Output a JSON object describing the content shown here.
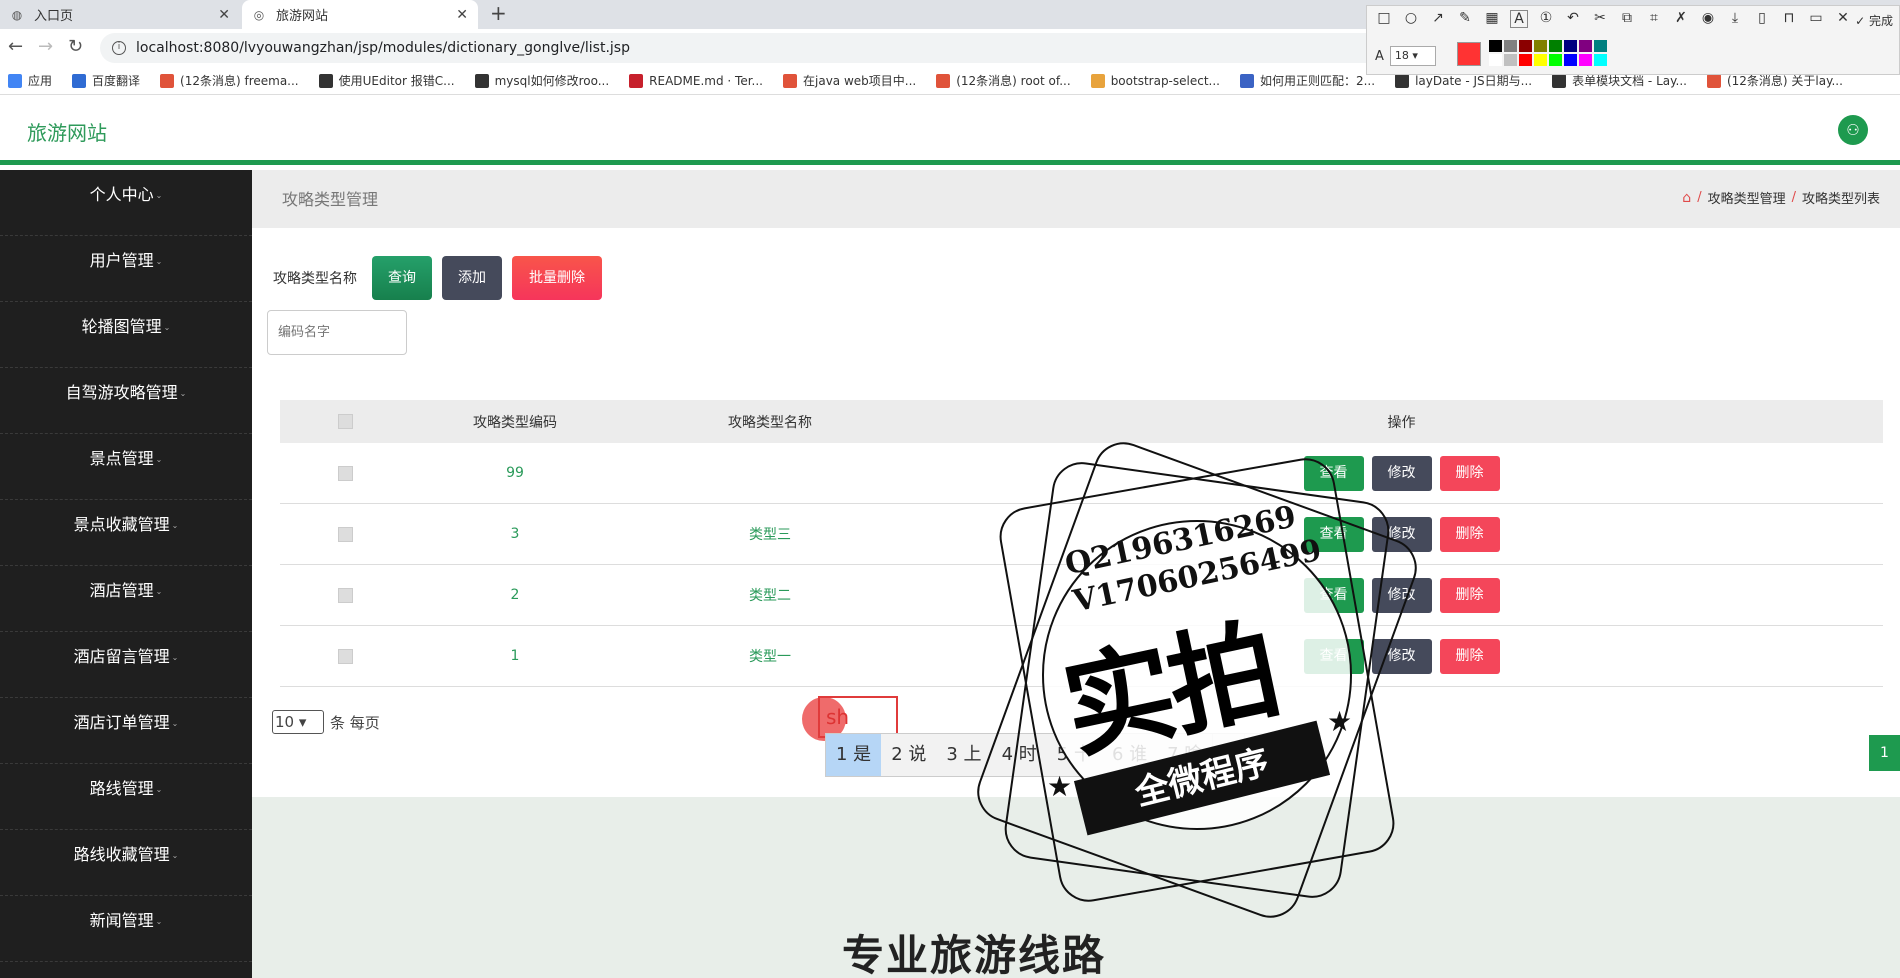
{
  "browser": {
    "tabs": [
      {
        "title": "入口页",
        "close": "✕"
      },
      {
        "title": "旅游网站",
        "close": "✕"
      }
    ],
    "new_tab": "+",
    "url": "localhost:8080/lvyouwangzhan/jsp/modules/dictionary_gonglve/list.jsp",
    "bookmarks": [
      {
        "label": "应用",
        "color": "#4285f4"
      },
      {
        "label": "百度翻译",
        "color": "#2f6bd3"
      },
      {
        "label": "(12条消息) freema...",
        "color": "#e0533a"
      },
      {
        "label": "使用UEditor 报错C...",
        "color": "#333333"
      },
      {
        "label": "mysql如何修改roo...",
        "color": "#333333"
      },
      {
        "label": "README.md · Ter...",
        "color": "#c7202c"
      },
      {
        "label": "在java web项目中...",
        "color": "#e0533a"
      },
      {
        "label": "(12条消息) root of...",
        "color": "#e0533a"
      },
      {
        "label": "bootstrap-select...",
        "color": "#e8a33c"
      },
      {
        "label": "如何用正则匹配：2...",
        "color": "#3b63c4"
      },
      {
        "label": "layDate - JS日期与...",
        "color": "#333333"
      },
      {
        "label": "表单模块文档 - Lay...",
        "color": "#333333"
      },
      {
        "label": "(12条消息) 关于lay...",
        "color": "#e0533a"
      }
    ]
  },
  "snap_tool": {
    "done_label": "完成",
    "font_size": "18",
    "current_color": "#ff3333",
    "palette": [
      "#000000",
      "#808080",
      "#8b0000",
      "#808000",
      "#008000",
      "#000080",
      "#800080",
      "#008080",
      "#ffffff",
      "#c0c0c0",
      "#ff0000",
      "#ffff00",
      "#00ff00",
      "#0000ff",
      "#ff00ff",
      "#00ffff"
    ]
  },
  "header": {
    "brand": "旅游网站"
  },
  "sidebar": {
    "items": [
      {
        "label": "个人中心"
      },
      {
        "label": "用户管理"
      },
      {
        "label": "轮播图管理"
      },
      {
        "label": "自驾游攻略管理"
      },
      {
        "label": "景点管理"
      },
      {
        "label": "景点收藏管理"
      },
      {
        "label": "酒店管理"
      },
      {
        "label": "酒店留言管理"
      },
      {
        "label": "酒店订单管理"
      },
      {
        "label": "路线管理"
      },
      {
        "label": "路线收藏管理"
      },
      {
        "label": "新闻管理"
      }
    ]
  },
  "page": {
    "title": "攻略类型管理",
    "breadcrumb": [
      "攻略类型管理",
      "攻略类型列表"
    ],
    "search_label": "攻略类型名称",
    "search_placeholder": "编码名字",
    "buttons": {
      "query": "查询",
      "add": "添加",
      "batch_delete": "批量删除"
    },
    "table": {
      "headers": {
        "code": "攻略类型编码",
        "name": "攻略类型名称",
        "ops": "操作"
      },
      "rows": [
        {
          "code": "99",
          "name": ""
        },
        {
          "code": "3",
          "name": "类型三"
        },
        {
          "code": "2",
          "name": "类型二"
        },
        {
          "code": "1",
          "name": "类型一"
        }
      ],
      "op_labels": {
        "view": "查看",
        "edit": "修改",
        "delete": "删除"
      }
    },
    "pager": {
      "page_size": "10",
      "page_size_suffix": "条 每页",
      "current_page": "1"
    },
    "footer_title": "专业旅游线路"
  },
  "ime": {
    "composing": "sh",
    "candidates": [
      "1 是",
      "2 说",
      "3 上",
      "4 时",
      "5 十",
      "6 谁",
      "7 啥"
    ],
    "prev": "‹",
    "next": "›",
    "emoji": "☺"
  },
  "watermark": {
    "line1": "Q2196316269",
    "line2": "V17060256499",
    "big_text": "实拍",
    "ribbon_text": "全微程序"
  }
}
